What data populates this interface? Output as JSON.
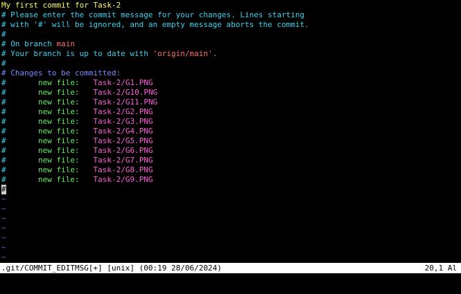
{
  "editor": {
    "title_line": "My first commit for Task-2",
    "comments": {
      "please": "# Please enter the commit message for your changes. Lines starting",
      "with": "# with '#' will be ignored, and an empty message aborts the commit.",
      "empty": "#",
      "on_branch_prefix": "# On branch ",
      "branch": "main",
      "up_to_date_prefix": "# Your branch is up to date with ",
      "remote": "'origin/main'",
      "up_to_date_suffix": ".",
      "changes_header": "# Changes to be committed:"
    },
    "new_file_label": "new file:",
    "files": [
      "Task-2/G1.PNG",
      "Task-2/G10.PNG",
      "Task-2/G11.PNG",
      "Task-2/G2.PNG",
      "Task-2/G3.PNG",
      "Task-2/G4.PNG",
      "Task-2/G5.PNG",
      "Task-2/G6.PNG",
      "Task-2/G7.PNG",
      "Task-2/G8.PNG",
      "Task-2/G9.PNG"
    ],
    "cursor_line": "#",
    "tilde": "~",
    "tilde_count": 7
  },
  "statusbar": {
    "left": ".git/COMMIT_EDITMSG[+] [unix] (00:19 28/06/2024)",
    "right": "20,1 Al"
  },
  "colors": {
    "background": "#000000",
    "title": "#ffff5f",
    "comment": "#38d4f0",
    "branch": "#ff6b6b",
    "header": "#7b8cff",
    "new_file": "#5ff05f",
    "filename": "#ff5fd7",
    "tilde": "#4a74c8",
    "statusbar_bg": "#ffffff"
  }
}
